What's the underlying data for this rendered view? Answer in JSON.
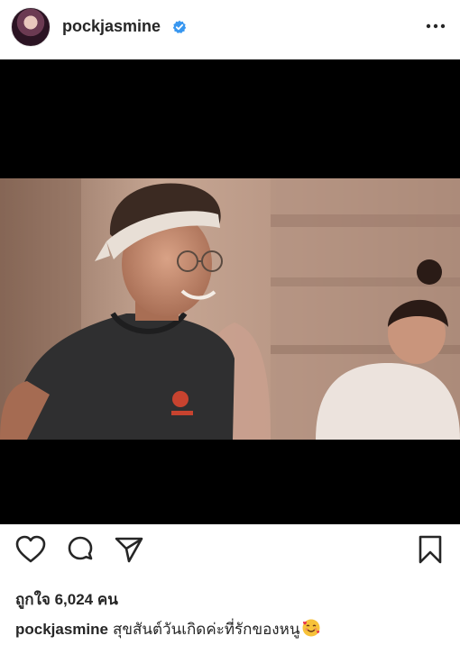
{
  "post": {
    "username": "pockjasmine",
    "verified": true,
    "likes_text": "ถูกใจ 6,024 คน",
    "caption_user": "pockjasmine",
    "caption_text": "สุขสันต์วันเกิดค่ะที่รักของหนู",
    "caption_emoji": "smiling-face-with-hearts"
  },
  "icons": {
    "like": "heart-icon",
    "comment": "comment-icon",
    "share": "paper-plane-icon",
    "save": "bookmark-icon",
    "more": "more-options-icon"
  },
  "colors": {
    "text": "#262626",
    "verified_blue": "#3897f0",
    "media_background": "#000000"
  }
}
